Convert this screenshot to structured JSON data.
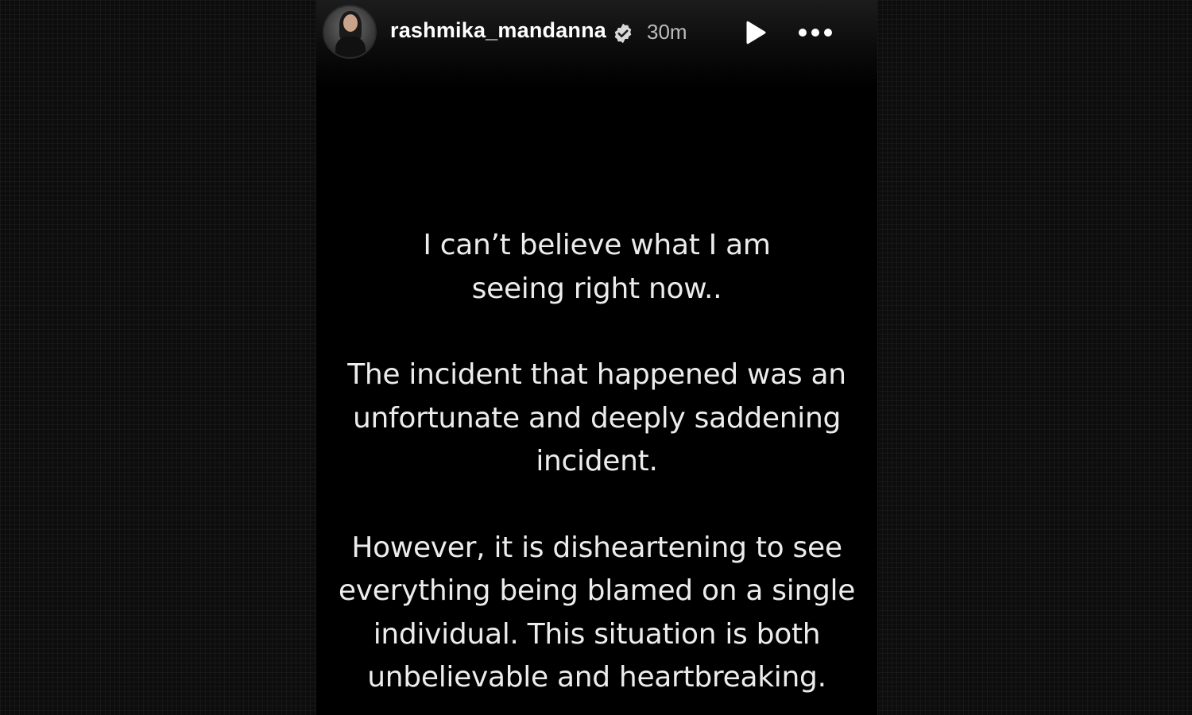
{
  "story": {
    "username": "rashmika_mandanna",
    "verified_icon": "verified-badge-icon",
    "time": "30m",
    "play_icon": "play-icon",
    "more_icon": "more-options-icon",
    "paragraphs": [
      "I can’t believe what I am seeing right now..",
      "The incident that happened was an unfortunate and deeply saddening incident.",
      "However, it is disheartening to see everything being blamed on a single individual. This situation is both unbelievable and heartbreaking."
    ]
  },
  "colors": {
    "background": "#000000",
    "text": "#ececec",
    "username": "#ffffff",
    "timestamp": "#bdbdbd"
  }
}
